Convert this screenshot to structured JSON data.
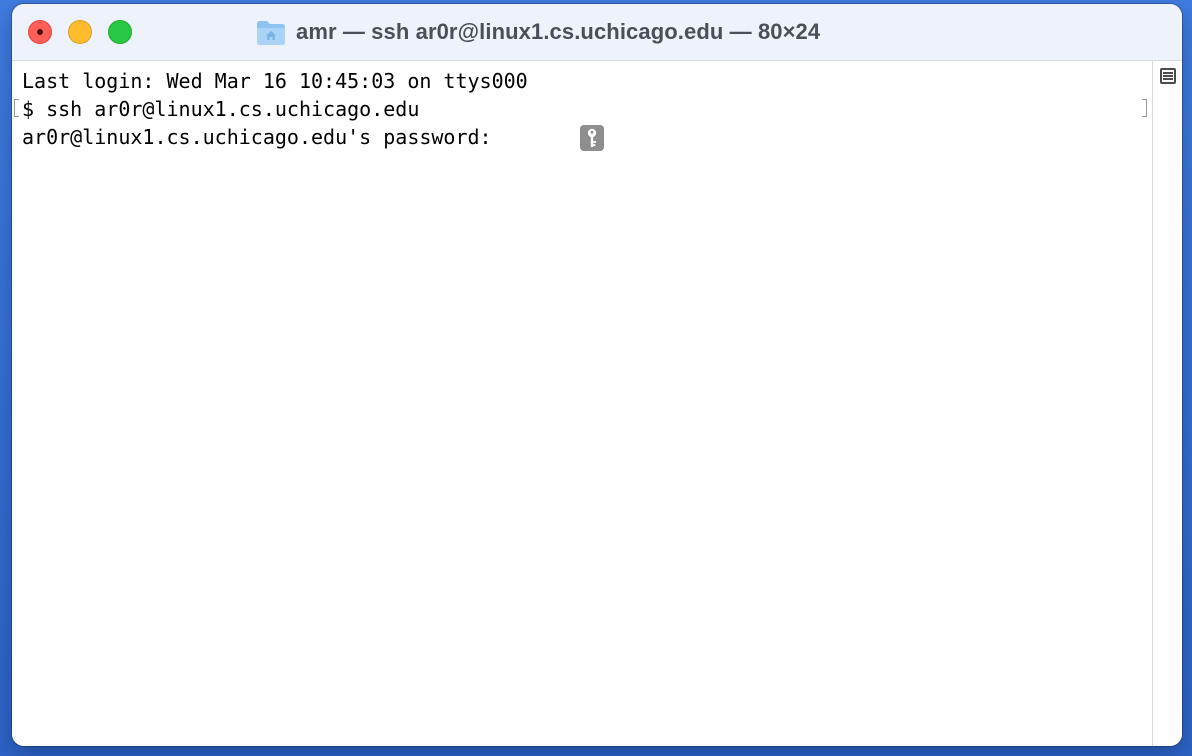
{
  "window": {
    "title": "amr — ssh ar0r@linux1.cs.uchicago.edu — 80×24",
    "folder_icon": "home-folder-icon"
  },
  "terminal": {
    "lines": [
      "Last login: Wed Mar 16 10:45:03 on ttys000",
      "$ ssh ar0r@linux1.cs.uchicago.edu",
      "ar0r@linux1.cs.uchicago.edu's password: "
    ],
    "password_indicator_icon": "key-icon"
  },
  "colors": {
    "close": "#fe5f57",
    "minimize": "#febc2e",
    "zoom": "#28c840",
    "desktop": "#356fd6",
    "titlebar": "#eef2fa",
    "terminal_background": "#ffffff",
    "text": "#000000"
  }
}
